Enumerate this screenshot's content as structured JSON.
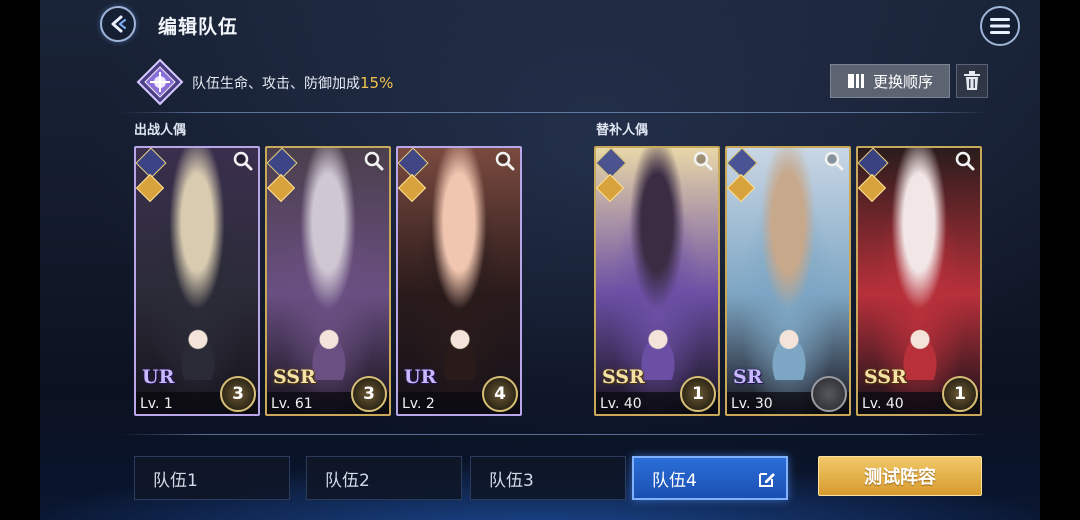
{
  "header": {
    "title": "编辑队伍",
    "back_icon": "back-arrow-icon",
    "menu_icon": "hamburger-menu-icon"
  },
  "bonus": {
    "text": "队伍生命、攻击、防御加成",
    "percent": "15%",
    "swap_label": "更换顺序",
    "trash_icon": "trash-icon"
  },
  "sections": {
    "battle": "出战人偶",
    "reserve": "替补人偶"
  },
  "battle_cards": [
    {
      "rarity": "UR",
      "level": "Lv.  1",
      "stars": "3",
      "frame": "ur",
      "colors": [
        "#3a2f4d",
        "#d8cbb0",
        "#2b2b38"
      ]
    },
    {
      "rarity": "SSR",
      "level": "Lv. 61",
      "stars": "3",
      "frame": "ssr",
      "colors": [
        "#4b3f4c",
        "#cfc7d2",
        "#6a4f82"
      ]
    },
    {
      "rarity": "UR",
      "level": "Lv.  2",
      "stars": "4",
      "frame": "ur",
      "colors": [
        "#7a4a3f",
        "#f1c6b0",
        "#2a1b1b"
      ]
    }
  ],
  "reserve_cards": [
    {
      "rarity": "SSR",
      "level": "Lv. 40",
      "stars": "1",
      "frame": "ssr",
      "colors": [
        "#e8d7a8",
        "#3b2c44",
        "#6b4fa4"
      ]
    },
    {
      "rarity": "SR",
      "level": "Lv. 30",
      "stars": "",
      "frame": "sr",
      "colors": [
        "#c9d6e4",
        "#c8a88a",
        "#7da6c4"
      ]
    },
    {
      "rarity": "SSR",
      "level": "Lv. 40",
      "stars": "1",
      "frame": "ssr",
      "colors": [
        "#2a1c1c",
        "#f2e6e6",
        "#b8303a"
      ]
    }
  ],
  "tabs": [
    {
      "label": "队伍1",
      "active": false
    },
    {
      "label": "队伍2",
      "active": false
    },
    {
      "label": "队伍3",
      "active": false
    },
    {
      "label": "队伍4",
      "active": true
    }
  ],
  "test_button": "测试阵容",
  "colors": {
    "accent_gold": "#f2c14e",
    "tab_active": "#2b6fd8",
    "frame_gold": "#c9a85a",
    "frame_ur": "#b9a6e8"
  }
}
